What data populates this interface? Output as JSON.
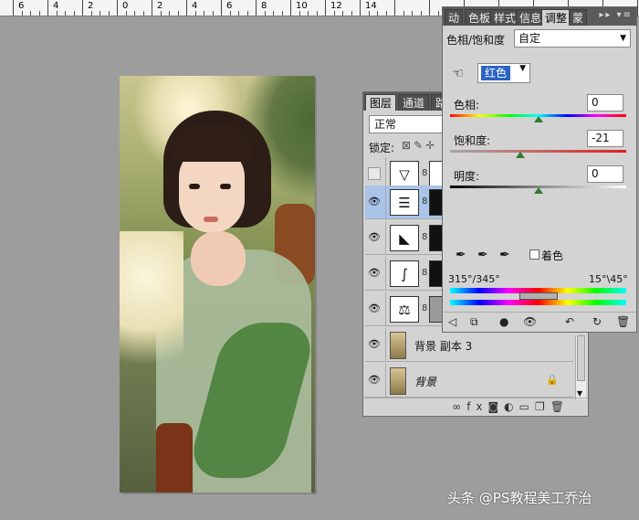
{
  "ruler": {
    "labels": [
      "6",
      "4",
      "2",
      "0",
      "2",
      "4",
      "6",
      "8",
      "10",
      "12",
      "14"
    ]
  },
  "layers": {
    "tabs": [
      "图层",
      "通道",
      "路"
    ],
    "blend_mode": "正常",
    "lock_label": "锁定:",
    "rows": [
      {
        "name": ""
      },
      {
        "name": ""
      },
      {
        "name": ""
      },
      {
        "name": ""
      },
      {
        "name": ""
      },
      {
        "name": "背景 副本 3"
      },
      {
        "name": "背景",
        "locked": true
      }
    ]
  },
  "adjustments": {
    "tabs": [
      "动",
      "色板",
      "样式",
      "信息",
      "调整",
      "蒙"
    ],
    "title": "色相/饱和度",
    "preset": "自定",
    "channel": "红色",
    "hue": {
      "label": "色相:",
      "value": "0"
    },
    "saturation": {
      "label": "饱和度:",
      "value": "-21"
    },
    "lightness": {
      "label": "明度:",
      "value": "0"
    },
    "colorize_label": "着色",
    "range_left": "315°/345°",
    "range_right": "15°\\45°"
  },
  "watermark": "头条 @PS教程美工乔治"
}
